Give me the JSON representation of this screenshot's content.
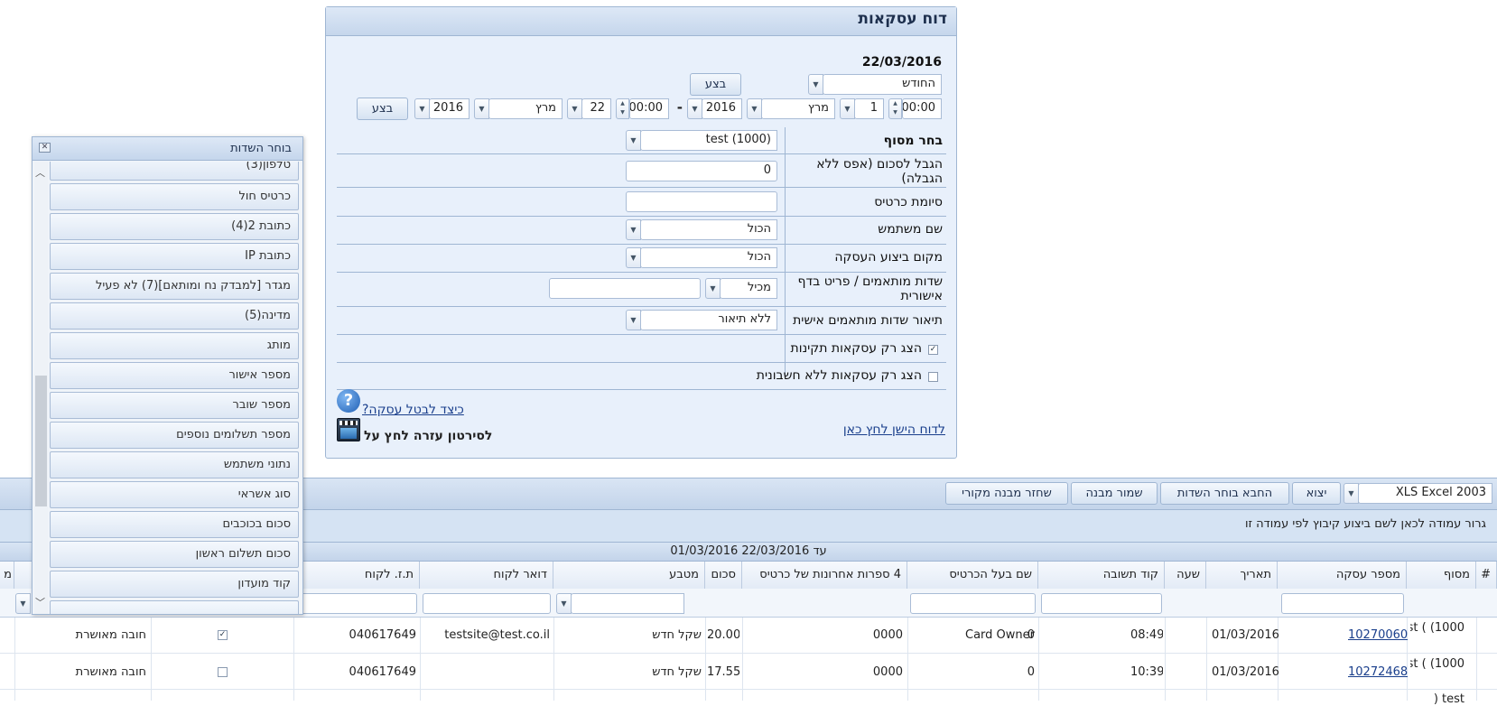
{
  "report": {
    "title": "דוח עסקאות",
    "date": "22/03/2016",
    "period_select": "החודש",
    "execute_label": "בצע",
    "from_time": "00:00",
    "from_day": "1",
    "from_month": "מרץ",
    "from_year": "2016",
    "dash": "-",
    "to_time": "00:00",
    "to_day": "22",
    "to_month": "מרץ",
    "to_year": "2016",
    "execute2_label": "בצע",
    "terminal_label": "בחר מסוף",
    "terminal_value": "test  (1000)",
    "amount_limit_label": "הגבל לסכום (אפס ללא הגבלה)",
    "amount_limit_value": "0",
    "card_suffix_label": "סיומת כרטיס",
    "card_suffix_value": "",
    "username_label": "שם משתמש",
    "username_value": "הכול",
    "location_label": "מקום ביצוע העסקה",
    "location_value": "הכול",
    "custom_fields_label": "שדות מותאמים / פריט בדף אישורית",
    "custom_fields_op": "מכיל",
    "custom_fields_value": "",
    "custom_desc_label": "תיאור שדות מותאמים אישית",
    "custom_desc_value": "ללא תיאור",
    "valid_only_label": "הצג רק עסקאות תקינות",
    "valid_only_checked": true,
    "no_invoice_label": "הצג רק עסקאות ללא חשבונית",
    "no_invoice_checked": false,
    "cancel_help_link": "כיצד לבטל עסקה?",
    "video_help_label": "לסירטון עזרה לחץ על",
    "old_report_link": "לדוח הישן לחץ כאן"
  },
  "toolbar": {
    "export_format": "XLS Excel 2003",
    "export_label": "יצוא",
    "hide_chooser_label": "החבא בוחר השדות",
    "save_layout_label": "שמור מבנה",
    "restore_layout_label": "שחזר מבנה מקורי"
  },
  "grid": {
    "group_hint": "גרור עמודה לכאן לשם ביצוע קיבוץ לפי עמודה זו",
    "date_range": "01/03/2016 עד 22/03/2016",
    "columns": [
      "#",
      "מסוף",
      "מספר עסקה",
      "תאריך",
      "שעה",
      "קוד תשובה",
      "שם בעל הכרטיס",
      "4 ספרות אחרונות של כרטיס",
      "סכום",
      "מטבע",
      "דואר לקוח",
      "ת.ז. לקוח",
      "מ"
    ],
    "rows": [
      {
        "terminal": "test ( (1000",
        "deal": "10270060",
        "date": "01/03/2016",
        "time": "08:49",
        "code": "0",
        "owner": "Card Owner",
        "last4": "0000",
        "amount": "20.00",
        "currency": "שקל חדש",
        "email": "testsite@test.co.il",
        "id": "040617649",
        "checked": true,
        "status": "חובה מאושרת"
      },
      {
        "terminal": "test ( (1000",
        "deal": "10272468",
        "date": "01/03/2016",
        "time": "10:39",
        "code": "0",
        "owner": "",
        "last4": "0000",
        "amount": "17.55",
        "currency": "שקל חדש",
        "email": "",
        "id": "040617649",
        "checked": false,
        "status": "חובה מאושרת"
      },
      {
        "terminal": "test (",
        "deal": "",
        "date": "",
        "time": "",
        "code": "",
        "owner": "",
        "last4": "",
        "amount": "",
        "currency": "",
        "email": "",
        "id": "",
        "checked": false,
        "status": ""
      }
    ]
  },
  "field_chooser": {
    "title": "בוחר השדות",
    "items": [
      "טלפון(3)",
      "כרטיס חול",
      "כתובת 2(4)",
      "כתובת IP",
      "מגדר [למבדק נח ומותאם](7) לא פעיל",
      "מדינה(5)",
      "מותג",
      "מספר אישור",
      "מספר שובר",
      "מספר תשלומים נוספים",
      "נתוני משתמש",
      "סוג אשראי",
      "סכום בכוכבים",
      "סכום תשלום ראשון",
      "קוד מועדון"
    ]
  },
  "icons": {
    "help": "help-icon",
    "video": "video-icon",
    "close": "close-icon"
  }
}
